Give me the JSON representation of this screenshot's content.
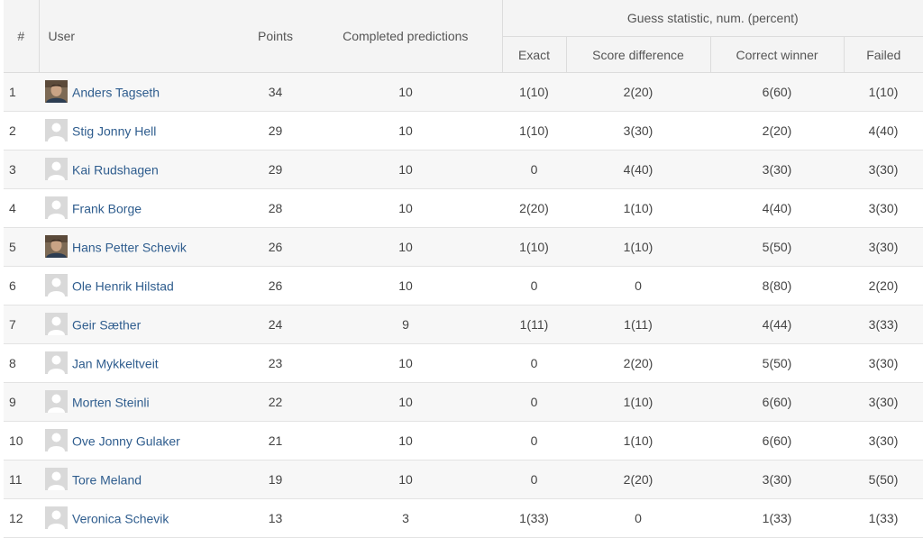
{
  "header": {
    "num": "#",
    "user": "User",
    "points": "Points",
    "completed": "Completed predictions",
    "group": "Guess statistic, num. (percent)",
    "exact": "Exact",
    "score_diff": "Score difference",
    "correct_winner": "Correct winner",
    "failed": "Failed"
  },
  "rows": [
    {
      "rank": "1",
      "name": "Anders Tagseth",
      "avatar": "photo-avatar-icon",
      "points": "34",
      "completed": "10",
      "exact": "1(10)",
      "score_diff": "2(20)",
      "winner": "6(60)",
      "failed": "1(10)"
    },
    {
      "rank": "2",
      "name": "Stig Jonny Hell",
      "avatar": "default-avatar-icon",
      "points": "29",
      "completed": "10",
      "exact": "1(10)",
      "score_diff": "3(30)",
      "winner": "2(20)",
      "failed": "4(40)"
    },
    {
      "rank": "3",
      "name": "Kai Rudshagen",
      "avatar": "default-avatar-icon",
      "points": "29",
      "completed": "10",
      "exact": "0",
      "score_diff": "4(40)",
      "winner": "3(30)",
      "failed": "3(30)"
    },
    {
      "rank": "4",
      "name": "Frank Borge",
      "avatar": "default-avatar-icon",
      "points": "28",
      "completed": "10",
      "exact": "2(20)",
      "score_diff": "1(10)",
      "winner": "4(40)",
      "failed": "3(30)"
    },
    {
      "rank": "5",
      "name": "Hans Petter Schevik",
      "avatar": "photo-avatar-icon",
      "points": "26",
      "completed": "10",
      "exact": "1(10)",
      "score_diff": "1(10)",
      "winner": "5(50)",
      "failed": "3(30)"
    },
    {
      "rank": "6",
      "name": "Ole Henrik Hilstad",
      "avatar": "default-avatar-icon",
      "points": "26",
      "completed": "10",
      "exact": "0",
      "score_diff": "0",
      "winner": "8(80)",
      "failed": "2(20)"
    },
    {
      "rank": "7",
      "name": "Geir Sæther",
      "avatar": "default-avatar-icon",
      "points": "24",
      "completed": "9",
      "exact": "1(11)",
      "score_diff": "1(11)",
      "winner": "4(44)",
      "failed": "3(33)"
    },
    {
      "rank": "8",
      "name": "Jan Mykkeltveit",
      "avatar": "default-avatar-icon",
      "points": "23",
      "completed": "10",
      "exact": "0",
      "score_diff": "2(20)",
      "winner": "5(50)",
      "failed": "3(30)"
    },
    {
      "rank": "9",
      "name": "Morten Steinli",
      "avatar": "default-avatar-icon",
      "points": "22",
      "completed": "10",
      "exact": "0",
      "score_diff": "1(10)",
      "winner": "6(60)",
      "failed": "3(30)"
    },
    {
      "rank": "10",
      "name": "Ove Jonny Gulaker",
      "avatar": "default-avatar-icon",
      "points": "21",
      "completed": "10",
      "exact": "0",
      "score_diff": "1(10)",
      "winner": "6(60)",
      "failed": "3(30)"
    },
    {
      "rank": "11",
      "name": "Tore Meland",
      "avatar": "default-avatar-icon",
      "points": "19",
      "completed": "10",
      "exact": "0",
      "score_diff": "2(20)",
      "winner": "3(30)",
      "failed": "5(50)"
    },
    {
      "rank": "12",
      "name": "Veronica Schevik",
      "avatar": "default-avatar-icon",
      "points": "13",
      "completed": "3",
      "exact": "1(33)",
      "score_diff": "0",
      "winner": "1(33)",
      "failed": "1(33)"
    }
  ],
  "colors": {
    "link": "#2f5d8e",
    "header_bg": "#f4f4f4",
    "row_stripe": "#f7f7f7",
    "border": "#dcdcdc"
  }
}
